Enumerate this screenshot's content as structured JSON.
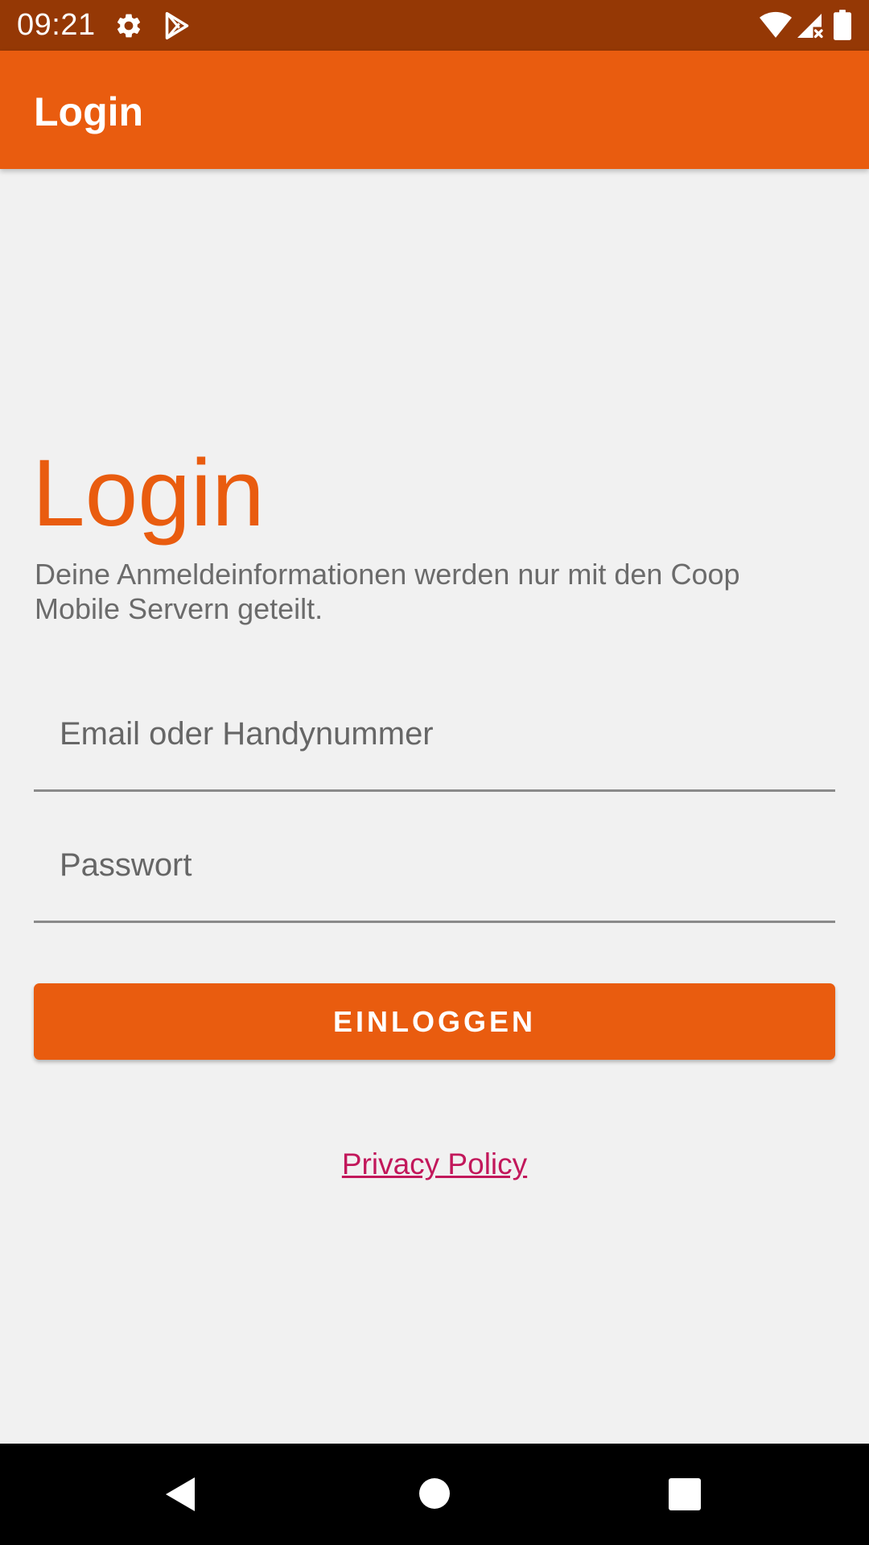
{
  "status_bar": {
    "time": "09:21",
    "icons": [
      "gear-icon",
      "play-store-icon",
      "wifi-icon",
      "signal-icon",
      "battery-icon"
    ]
  },
  "app_bar": {
    "title": "Login"
  },
  "main": {
    "heading": "Login",
    "subtitle": "Deine Anmeldeinformationen werden nur mit den Coop Mobile Servern geteilt.",
    "email_field": {
      "value": "",
      "placeholder": "Email oder Handynummer"
    },
    "password_field": {
      "value": "",
      "placeholder": "Passwort"
    },
    "login_button_label": "EINLOGGEN",
    "privacy_link": "Privacy Policy"
  },
  "nav_bar": {
    "buttons": [
      "back-icon",
      "home-icon",
      "recents-icon"
    ]
  },
  "colors": {
    "status_bar": "#953805",
    "accent": "#e95c0f",
    "background": "#f1f1f1",
    "link": "#c2185b"
  }
}
